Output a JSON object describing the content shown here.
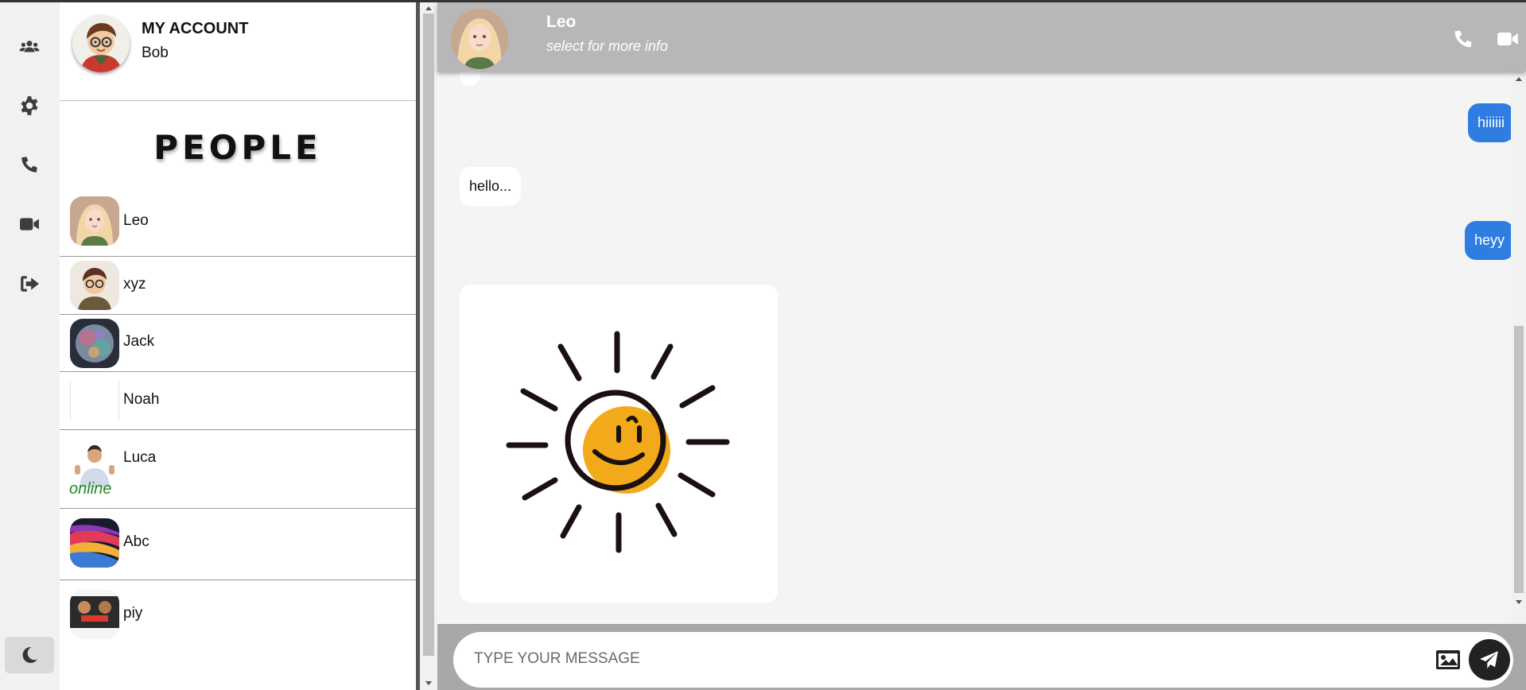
{
  "account": {
    "title": "MY ACCOUNT",
    "name": "Bob"
  },
  "people": {
    "heading": "PEOPLE",
    "contacts": [
      {
        "name": "Leo",
        "status": ""
      },
      {
        "name": "xyz",
        "status": ""
      },
      {
        "name": "Jack",
        "status": ""
      },
      {
        "name": "Noah",
        "status": ""
      },
      {
        "name": "Luca",
        "status": "online"
      },
      {
        "name": "Abc",
        "status": ""
      },
      {
        "name": "piy",
        "status": ""
      }
    ]
  },
  "chat": {
    "contact_name": "Leo",
    "contact_sub": "select for more info",
    "messages": [
      {
        "direction": "out",
        "text": "hiiiiii"
      },
      {
        "direction": "in",
        "text": "hello..."
      },
      {
        "direction": "out",
        "text": "heyy"
      },
      {
        "direction": "in",
        "type": "image",
        "alt": "smiling sun sticker"
      }
    ]
  },
  "composer": {
    "placeholder": "TYPE YOUR MESSAGE"
  },
  "icons": {
    "rail": [
      "users-icon",
      "gear-icon",
      "phone-icon",
      "video-icon",
      "logout-icon",
      "moon-icon"
    ],
    "header": [
      "phone-icon",
      "video-icon"
    ],
    "composer": [
      "image-icon",
      "send-icon"
    ]
  },
  "colors": {
    "outgoing_bubble": "#2f7de1",
    "header_bg": "#b7b7b7",
    "online": "#1f8a1f"
  }
}
